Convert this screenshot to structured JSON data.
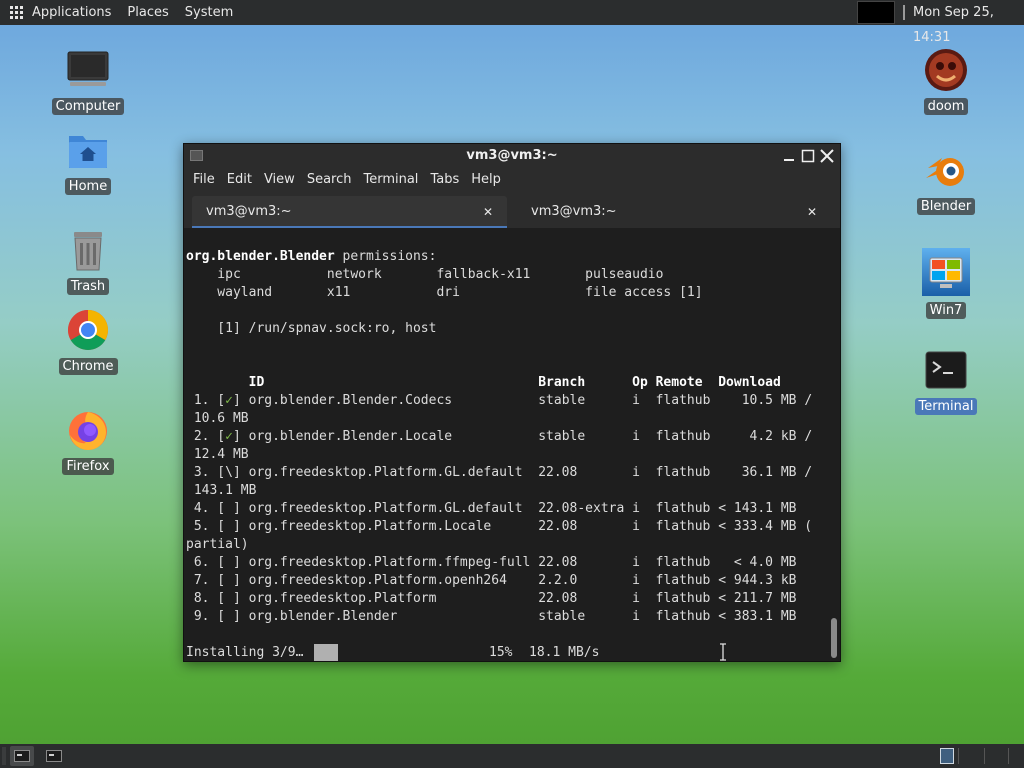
{
  "top_panel": {
    "menus": [
      "Applications",
      "Places",
      "System"
    ],
    "clock": "Mon Sep 25, 14:31"
  },
  "desktop_icons": {
    "computer": "Computer",
    "home": "Home",
    "trash": "Trash",
    "chrome": "Chrome",
    "firefox": "Firefox",
    "doom": "doom",
    "blender": "Blender",
    "win7": "Win7",
    "terminal": "Terminal"
  },
  "window": {
    "title": "vm3@vm3:~",
    "menu": [
      "File",
      "Edit",
      "View",
      "Search",
      "Terminal",
      "Tabs",
      "Help"
    ],
    "tabs": [
      {
        "label": "vm3@vm3:~",
        "active": true
      },
      {
        "label": "vm3@vm3:~",
        "active": false
      }
    ]
  },
  "terminal": {
    "app_id": "org.blender.Blender",
    "permissions_suffix": " permissions:",
    "lines": [
      "    ipc           network       fallback-x11       pulseaudio",
      "    wayland       x11           dri                file access [1]",
      "",
      "    [1] /run/spnav.sock:ro, host",
      "",
      "",
      "        ID                                   Branch      Op Remote  Download",
      " 1. [✓] org.blender.Blender.Codecs           stable      i  flathub    10.5 MB /",
      " 10.6 MB",
      " 2. [✓] org.blender.Blender.Locale           stable      i  flathub     4.2 kB /",
      " 12.4 MB",
      " 3. [\\] org.freedesktop.Platform.GL.default  22.08       i  flathub    36.1 MB /",
      " 143.1 MB",
      " 4. [ ] org.freedesktop.Platform.GL.default  22.08-extra i  flathub < 143.1 MB",
      " 5. [ ] org.freedesktop.Platform.Locale      22.08       i  flathub < 333.4 MB (",
      "partial)",
      " 6. [ ] org.freedesktop.Platform.ffmpeg-full 22.08       i  flathub   < 4.0 MB",
      " 7. [ ] org.freedesktop.Platform.openh264    2.2.0       i  flathub < 944.3 kB",
      " 8. [ ] org.freedesktop.Platform             22.08       i  flathub < 211.7 MB",
      " 9. [ ] org.blender.Blender                  stable      i  flathub < 383.1 MB"
    ],
    "status": {
      "text": "Installing 3/9…",
      "percent": "15%",
      "speed": "18.1 MB/s",
      "progress": 0.15
    }
  },
  "colors": {
    "panel": "#2b2d2e",
    "terminal_bg": "#1e1e1e",
    "check_green": "#7fb84a",
    "accent": "#4a78b8"
  },
  "icons": [
    "apps-grid-icon",
    "computer-icon",
    "home-folder-icon",
    "trash-icon",
    "chrome-icon",
    "firefox-icon",
    "doom-icon",
    "blender-icon",
    "win7-icon",
    "terminal-icon"
  ]
}
